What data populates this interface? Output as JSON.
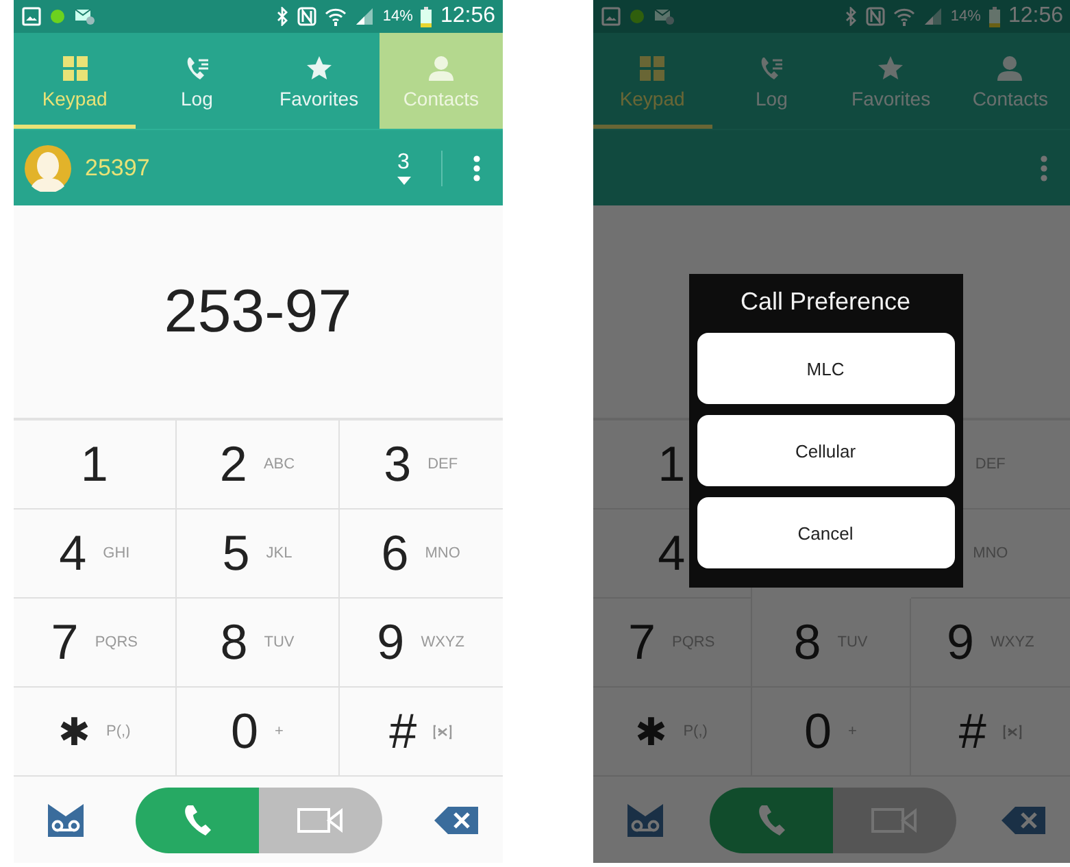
{
  "phones": [
    {
      "status_bar": {
        "battery": "14%",
        "time": "12:56"
      },
      "tabs": [
        {
          "label": "Keypad",
          "selected": true,
          "pressed": false
        },
        {
          "label": "Log",
          "selected": false,
          "pressed": false
        },
        {
          "label": "Favorites",
          "selected": false,
          "pressed": false
        },
        {
          "label": "Contacts",
          "selected": false,
          "pressed": true
        }
      ],
      "header": {
        "contact_number": "25397",
        "sim_count": "3"
      },
      "display_number": "253-97",
      "keys": [
        {
          "digit": "1"
        },
        {
          "digit": "2",
          "letters": "ABC"
        },
        {
          "digit": "3",
          "letters": "DEF"
        },
        {
          "digit": "4",
          "letters": "GHI"
        },
        {
          "digit": "5",
          "letters": "JKL"
        },
        {
          "digit": "6",
          "letters": "MNO"
        },
        {
          "digit": "7",
          "letters": "PQRS"
        },
        {
          "digit": "8",
          "letters": "TUV"
        },
        {
          "digit": "9",
          "letters": "WXYZ"
        },
        {
          "digit": "✱",
          "letters": "P(,)"
        },
        {
          "digit": "0",
          "letters": "+"
        },
        {
          "digit": "#"
        }
      ]
    },
    {
      "status_bar": {
        "battery": "14%",
        "time": "12:56"
      },
      "tabs": [
        {
          "label": "Keypad",
          "selected": true,
          "pressed": false
        },
        {
          "label": "Log",
          "selected": false,
          "pressed": false
        },
        {
          "label": "Favorites",
          "selected": false,
          "pressed": false
        },
        {
          "label": "Contacts",
          "selected": false,
          "pressed": false
        }
      ],
      "keys": [
        {
          "digit": "1"
        },
        {
          "kind": "covered"
        },
        {
          "letters": "DEF"
        },
        {
          "digit": "4"
        },
        {
          "kind": "covered"
        },
        {
          "letters": "MNO"
        },
        {
          "digit": "7",
          "letters": "PQRS"
        },
        {
          "digit": "8",
          "letters": "TUV"
        },
        {
          "digit": "9",
          "letters": "WXYZ"
        },
        {
          "digit": "✱",
          "letters": "P(,)"
        },
        {
          "digit": "0",
          "letters": "+"
        },
        {
          "digit": "#"
        }
      ],
      "dialog": {
        "title": "Call Preference",
        "options": [
          "MLC",
          "Cellular",
          "Cancel"
        ]
      }
    }
  ]
}
